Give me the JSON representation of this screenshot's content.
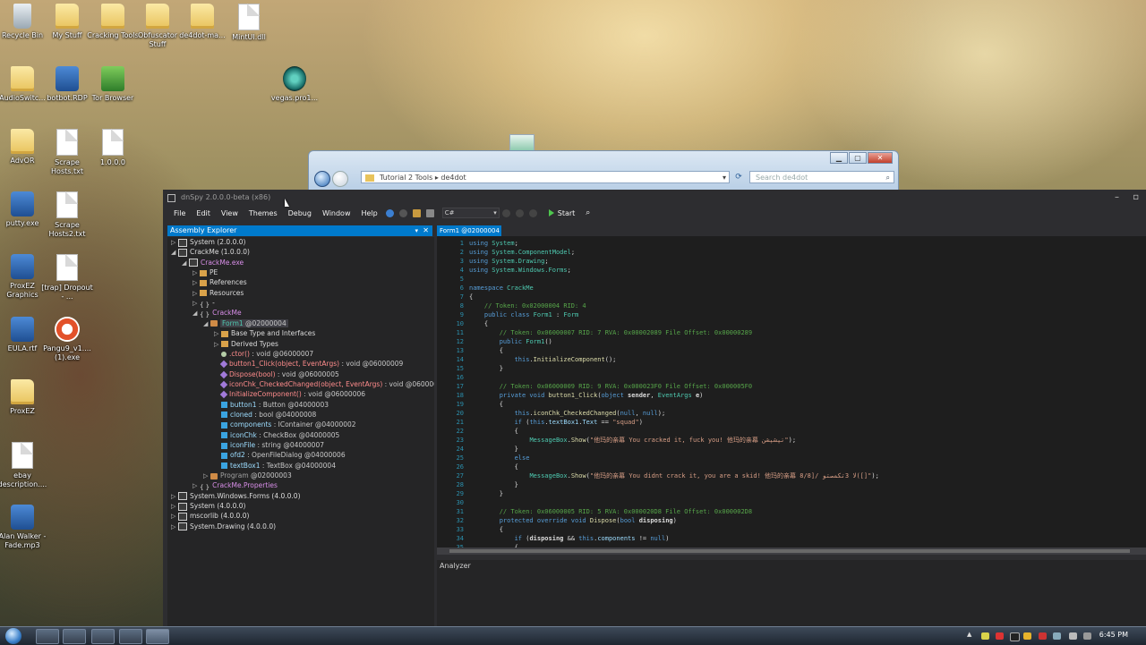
{
  "desktop": {
    "icons": [
      {
        "label": "Recycle Bin",
        "type": "bin"
      },
      {
        "label": "My Stuff",
        "type": "folder"
      },
      {
        "label": "Cracking Tools",
        "type": "folder"
      },
      {
        "label": "Obfuscator Stuff",
        "type": "folder"
      },
      {
        "label": "de4dot-ma...",
        "type": "folder"
      },
      {
        "label": "MintUI.dll",
        "type": "doc"
      },
      {
        "label": "AudioSwitc...",
        "type": "folder"
      },
      {
        "label": "botbot.RDP",
        "type": "app"
      },
      {
        "label": "Tor Browser",
        "type": "green"
      },
      {
        "label": "vegas.pro1...",
        "type": "teal"
      },
      {
        "label": "AdvOR",
        "type": "folder"
      },
      {
        "label": "Scrape Hosts.txt",
        "type": "doc"
      },
      {
        "label": "1.0.0.0",
        "type": "doc"
      },
      {
        "label": "putty.exe",
        "type": "app"
      },
      {
        "label": "Scrape Hosts2.txt",
        "type": "doc"
      },
      {
        "label": "ProxEZ Graphics",
        "type": "app"
      },
      {
        "label": "[trap] Dropout - ...",
        "type": "doc"
      },
      {
        "label": "EULA.rtf",
        "type": "app"
      },
      {
        "label": "Pangu9_v1.... (1).exe",
        "type": "orange"
      },
      {
        "label": "ProxEZ",
        "type": "folder"
      },
      {
        "label": "ebay description....",
        "type": "doc"
      },
      {
        "label": "Alan Walker - Fade.mp3",
        "type": "app"
      }
    ]
  },
  "explorer": {
    "address": [
      "Tutorial 2 Tools",
      "de4dot"
    ],
    "search_placeholder": "Search de4dot"
  },
  "dnspy": {
    "title": "dnSpy 2.0.0.0-beta (x86)",
    "menu": [
      "File",
      "Edit",
      "View",
      "Themes",
      "Debug",
      "Window",
      "Help"
    ],
    "language": "C#",
    "start_label": "Start",
    "assembly_explorer_title": "Assembly Explorer",
    "tree": [
      {
        "indent": 0,
        "arrow": "▷",
        "icon": "asm",
        "text": "System (2.0.0.0)",
        "cls": ""
      },
      {
        "indent": 0,
        "arrow": "◢",
        "icon": "asm",
        "text": "CrackMe (1.0.0.0)",
        "cls": ""
      },
      {
        "indent": 1,
        "arrow": "◢",
        "icon": "asm",
        "text": "CrackMe.exe",
        "cls": "c-mag"
      },
      {
        "indent": 2,
        "arrow": "▷",
        "icon": "fld",
        "text": "PE",
        "cls": ""
      },
      {
        "indent": 2,
        "arrow": "▷",
        "icon": "fld",
        "text": "References",
        "cls": ""
      },
      {
        "indent": 2,
        "arrow": "▷",
        "icon": "fld",
        "text": "Resources",
        "cls": ""
      },
      {
        "indent": 2,
        "arrow": "▷",
        "icon": "ns",
        "text": "-",
        "cls": ""
      },
      {
        "indent": 2,
        "arrow": "◢",
        "icon": "ns",
        "text": "CrackMe",
        "cls": "c-mag"
      },
      {
        "indent": 3,
        "arrow": "◢",
        "icon": "cls",
        "text": "Form1",
        "tok": " @02000004",
        "cls": "c-type",
        "selected": true
      },
      {
        "indent": 4,
        "arrow": "▷",
        "icon": "fld",
        "text": "Base Type and Interfaces",
        "cls": ""
      },
      {
        "indent": 4,
        "arrow": "▷",
        "icon": "fld",
        "text": "Derived Types",
        "cls": ""
      },
      {
        "indent": 4,
        "arrow": "",
        "icon": "ctor",
        "text": ".ctor()",
        "tok": " : void @06000007",
        "cls": "c-meth"
      },
      {
        "indent": 4,
        "arrow": "",
        "icon": "meth",
        "text": "button1_Click(object, EventArgs)",
        "tok": " : void @06000009",
        "cls": "c-meth"
      },
      {
        "indent": 4,
        "arrow": "",
        "icon": "meth",
        "text": "Dispose(bool)",
        "tok": " : void @06000005",
        "cls": "c-meth"
      },
      {
        "indent": 4,
        "arrow": "",
        "icon": "meth",
        "text": "iconChk_CheckedChanged(object, EventArgs)",
        "tok": " : void @0600000",
        "cls": "c-meth"
      },
      {
        "indent": 4,
        "arrow": "",
        "icon": "meth",
        "text": "InitializeComponent()",
        "tok": " : void @06000006",
        "cls": "c-meth"
      },
      {
        "indent": 4,
        "arrow": "",
        "icon": "field",
        "text": "button1",
        "tok": " : Button @04000003",
        "cls": "c-field"
      },
      {
        "indent": 4,
        "arrow": "",
        "icon": "field",
        "text": "cloned",
        "tok": " : bool @04000008",
        "cls": "c-field"
      },
      {
        "indent": 4,
        "arrow": "",
        "icon": "field",
        "text": "components",
        "tok": " : IContainer @04000002",
        "cls": "c-field"
      },
      {
        "indent": 4,
        "arrow": "",
        "icon": "field",
        "text": "iconChk",
        "tok": " : CheckBox @04000005",
        "cls": "c-field"
      },
      {
        "indent": 4,
        "arrow": "",
        "icon": "field",
        "text": "iconFile",
        "tok": " : string @04000007",
        "cls": "c-field"
      },
      {
        "indent": 4,
        "arrow": "",
        "icon": "field",
        "text": "ofd2",
        "tok": " : OpenFileDialog @04000006",
        "cls": "c-field"
      },
      {
        "indent": 4,
        "arrow": "",
        "icon": "field",
        "text": "textBox1",
        "tok": " : TextBox @04000004",
        "cls": "c-field"
      },
      {
        "indent": 3,
        "arrow": "▷",
        "icon": "cls",
        "text": "Program",
        "tok": " @02000003",
        "cls": "c-gray"
      },
      {
        "indent": 2,
        "arrow": "▷",
        "icon": "ns",
        "text": "CrackMe.Properties",
        "cls": "c-mag"
      },
      {
        "indent": 0,
        "arrow": "▷",
        "icon": "asm",
        "text": "System.Windows.Forms (4.0.0.0)",
        "cls": ""
      },
      {
        "indent": 0,
        "arrow": "▷",
        "icon": "asm",
        "text": "System (4.0.0.0)",
        "cls": ""
      },
      {
        "indent": 0,
        "arrow": "▷",
        "icon": "asm",
        "text": "mscorlib (4.0.0.0)",
        "cls": ""
      },
      {
        "indent": 0,
        "arrow": "▷",
        "icon": "asm",
        "text": "System.Drawing (4.0.0.0)",
        "cls": ""
      }
    ],
    "doc_tab": "Form1 @02000004",
    "code": [
      [
        [
          "kw",
          "using "
        ],
        [
          "ty",
          "System"
        ],
        [
          "id",
          ";"
        ]
      ],
      [
        [
          "kw",
          "using "
        ],
        [
          "ty",
          "System.ComponentModel"
        ],
        [
          "id",
          ";"
        ]
      ],
      [
        [
          "kw",
          "using "
        ],
        [
          "ty",
          "System.Drawing"
        ],
        [
          "id",
          ";"
        ]
      ],
      [
        [
          "kw",
          "using "
        ],
        [
          "ty",
          "System.Windows.Forms"
        ],
        [
          "id",
          ";"
        ]
      ],
      [],
      [
        [
          "kw",
          "namespace "
        ],
        [
          "ty",
          "CrackMe"
        ]
      ],
      [
        [
          "id",
          "{"
        ]
      ],
      [
        [
          "id",
          "    "
        ],
        [
          "cm",
          "// Token: 0x02000004 RID: 4"
        ]
      ],
      [
        [
          "id",
          "    "
        ],
        [
          "kw",
          "public class "
        ],
        [
          "ty",
          "Form1"
        ],
        [
          "id",
          " : "
        ],
        [
          "ty",
          "Form"
        ]
      ],
      [
        [
          "id",
          "    {"
        ]
      ],
      [
        [
          "id",
          "        "
        ],
        [
          "cm",
          "// Token: 0x06000007 RID: 7 RVA: 0x00002089 File Offset: 0x00000289"
        ]
      ],
      [
        [
          "id",
          "        "
        ],
        [
          "kw",
          "public "
        ],
        [
          "ty",
          "Form1"
        ],
        [
          "id",
          "()"
        ]
      ],
      [
        [
          "id",
          "        {"
        ]
      ],
      [
        [
          "id",
          "            "
        ],
        [
          "kw",
          "this"
        ],
        [
          "id",
          "."
        ],
        [
          "me",
          "InitializeComponent"
        ],
        [
          "id",
          "();"
        ]
      ],
      [
        [
          "id",
          "        }"
        ]
      ],
      [],
      [
        [
          "id",
          "        "
        ],
        [
          "cm",
          "// Token: 0x06000009 RID: 9 RVA: 0x000023F0 File Offset: 0x000005F0"
        ]
      ],
      [
        [
          "id",
          "        "
        ],
        [
          "kw",
          "private void "
        ],
        [
          "me",
          "button1_Click"
        ],
        [
          "id",
          "("
        ],
        [
          "kw",
          "object "
        ],
        [
          "bo",
          "sender"
        ],
        [
          "id",
          ", "
        ],
        [
          "ty",
          "EventArgs "
        ],
        [
          "bo",
          "e"
        ],
        [
          "id",
          ")"
        ]
      ],
      [
        [
          "id",
          "        {"
        ]
      ],
      [
        [
          "id",
          "            "
        ],
        [
          "kw",
          "this"
        ],
        [
          "id",
          "."
        ],
        [
          "me",
          "iconChk_CheckedChanged"
        ],
        [
          "id",
          "("
        ],
        [
          "kw",
          "null"
        ],
        [
          "id",
          ", "
        ],
        [
          "kw",
          "null"
        ],
        [
          "id",
          ");"
        ]
      ],
      [
        [
          "id",
          "            "
        ],
        [
          "kw",
          "if "
        ],
        [
          "id",
          "("
        ],
        [
          "kw",
          "this"
        ],
        [
          "id",
          "."
        ],
        [
          "pr",
          "textBox1"
        ],
        [
          "id",
          "."
        ],
        [
          "pr",
          "Text"
        ],
        [
          "id",
          " == "
        ],
        [
          "st",
          "\"squad\""
        ],
        [
          "id",
          ")"
        ]
      ],
      [
        [
          "id",
          "            {"
        ]
      ],
      [
        [
          "id",
          "                "
        ],
        [
          "ty",
          "MessageBox"
        ],
        [
          "id",
          "."
        ],
        [
          "me",
          "Show"
        ],
        [
          "id",
          "("
        ],
        [
          "st",
          "\"他玛的亲幕 You cracked it, fuck you! 他玛的亲幕 تپشپشن\""
        ],
        [
          "id",
          ");"
        ]
      ],
      [
        [
          "id",
          "            }"
        ]
      ],
      [
        [
          "id",
          "            "
        ],
        [
          "kw",
          "else"
        ]
      ],
      [
        [
          "id",
          "            {"
        ]
      ],
      [
        [
          "id",
          "                "
        ],
        [
          "ty",
          "MessageBox"
        ],
        [
          "id",
          "."
        ],
        [
          "me",
          "Show"
        ],
        [
          "id",
          "("
        ],
        [
          "st",
          "\"他玛的亲幕 You didnt crack it, you are a skid! 他玛的亲幕 8/8]/ ﻻ 3تکمصتو([]\""
        ],
        [
          "id",
          ");"
        ]
      ],
      [
        [
          "id",
          "            }"
        ]
      ],
      [
        [
          "id",
          "        }"
        ]
      ],
      [],
      [
        [
          "id",
          "        "
        ],
        [
          "cm",
          "// Token: 0x06000005 RID: 5 RVA: 0x000020D8 File Offset: 0x000002D8"
        ]
      ],
      [
        [
          "id",
          "        "
        ],
        [
          "kw",
          "protected override void "
        ],
        [
          "me",
          "Dispose"
        ],
        [
          "id",
          "("
        ],
        [
          "kw",
          "bool "
        ],
        [
          "bo",
          "disposing"
        ],
        [
          "id",
          ")"
        ]
      ],
      [
        [
          "id",
          "        {"
        ]
      ],
      [
        [
          "id",
          "            "
        ],
        [
          "kw",
          "if "
        ],
        [
          "id",
          "("
        ],
        [
          "bo",
          "disposing"
        ],
        [
          "id",
          " && "
        ],
        [
          "kw",
          "this"
        ],
        [
          "id",
          "."
        ],
        [
          "pr",
          "components"
        ],
        [
          "id",
          " != "
        ],
        [
          "kw",
          "null"
        ],
        [
          "id",
          ")"
        ]
      ],
      [
        [
          "id",
          "            {"
        ]
      ]
    ],
    "analyzer_label": "Analyzer"
  },
  "taskbar": {
    "clock": "6:45 PM"
  }
}
